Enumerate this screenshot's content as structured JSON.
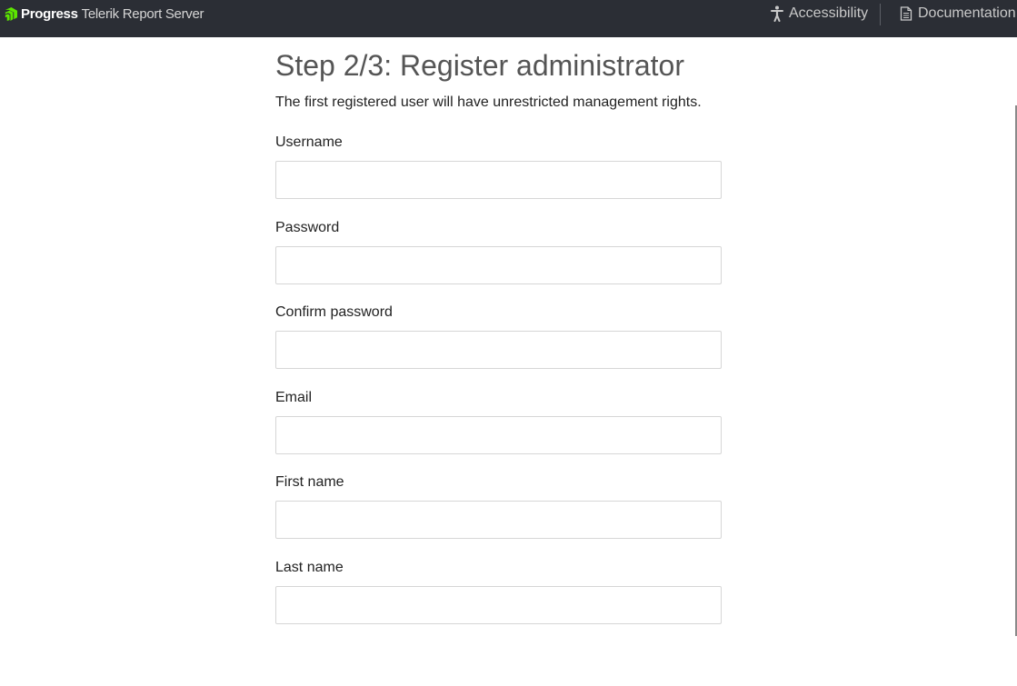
{
  "header": {
    "brand_company": "Progress",
    "brand_product": "Telerik Report Server",
    "accessibility_label": "Accessibility",
    "documentation_label": "Documentation"
  },
  "main": {
    "title": "Step 2/3: Register administrator",
    "subtitle": "The first registered user will have unrestricted management rights."
  },
  "form": {
    "fields": [
      {
        "label": "Username",
        "value": "",
        "placeholder": ""
      },
      {
        "label": "Password",
        "value": "",
        "placeholder": ""
      },
      {
        "label": "Confirm password",
        "value": "",
        "placeholder": ""
      },
      {
        "label": "Email",
        "value": "",
        "placeholder": ""
      },
      {
        "label": "First name",
        "value": "",
        "placeholder": ""
      },
      {
        "label": "Last name",
        "value": "",
        "placeholder": ""
      }
    ]
  },
  "colors": {
    "header_bg": "#2b2e35",
    "brand_accent": "#5ce500",
    "input_border": "#d6d6d6"
  },
  "icons": [
    "progress-logo-icon",
    "accessibility-icon",
    "document-icon"
  ]
}
